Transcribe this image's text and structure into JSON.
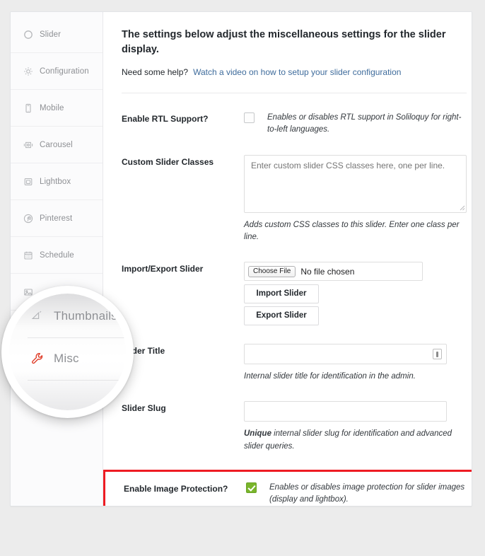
{
  "sidebar": {
    "items": [
      {
        "label": "Slider",
        "icon": "circle-icon"
      },
      {
        "label": "Configuration",
        "icon": "gear-icon"
      },
      {
        "label": "Mobile",
        "icon": "mobile-icon"
      },
      {
        "label": "Carousel",
        "icon": "carousel-icon"
      },
      {
        "label": "Lightbox",
        "icon": "lightbox-icon"
      },
      {
        "label": "Pinterest",
        "icon": "pinterest-icon"
      },
      {
        "label": "Schedule",
        "icon": "calendar-icon"
      },
      {
        "label": "",
        "icon": "image-icon"
      }
    ]
  },
  "magnifier": {
    "items": [
      {
        "label": "Thumbnails",
        "icon": "thumbnails-icon",
        "active": false
      },
      {
        "label": "Misc",
        "icon": "wrench-icon",
        "active": true
      }
    ]
  },
  "main": {
    "intro_title": "The settings below adjust the miscellaneous settings for the slider display.",
    "help_prefix": "Need some help?",
    "help_link": "Watch a video on how to setup your slider configuration",
    "rows": {
      "rtl": {
        "label": "Enable RTL Support?",
        "checked": false,
        "description": "Enables or disables RTL support in Soliloquy for right-to-left languages."
      },
      "custom_classes": {
        "label": "Custom Slider Classes",
        "placeholder": "Enter custom slider CSS classes here, one per line.",
        "value": "",
        "description": "Adds custom CSS classes to this slider. Enter one class per line."
      },
      "import_export": {
        "label": "Import/Export Slider",
        "choose_file_label": "Choose File",
        "file_status": "No file chosen",
        "import_button": "Import Slider",
        "export_button": "Export Slider"
      },
      "slider_title": {
        "label": "Slider Title",
        "label_visible": "er Title",
        "value": "",
        "description": "Internal slider title for identification in the admin.",
        "field_icon": "password-reveal-icon"
      },
      "slider_slug": {
        "label": "Slider Slug",
        "value": "",
        "description_bold": "Unique",
        "description": " internal slider slug for identification and advanced slider queries."
      },
      "image_protection": {
        "label": "Enable Image Protection?",
        "checked": true,
        "description": "Enables or disables image protection for slider images (display and lightbox)."
      }
    }
  },
  "colors": {
    "page_background": "#ececec",
    "card_background": "#ffffff",
    "sidebar_background": "#fbfbfc",
    "link": "#3f6c9c",
    "checkbox_checked": "#79b52b",
    "highlight_border": "#ee1c23",
    "active_icon": "#e0402c",
    "text": "#23282d",
    "muted_text": "#8e9094"
  }
}
